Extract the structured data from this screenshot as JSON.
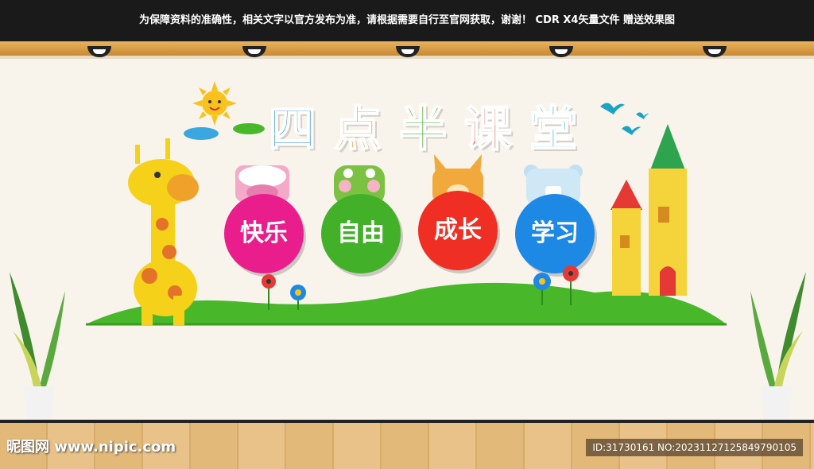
{
  "top_notice": "为保障资料的准确性，相关文字以官方发布为准，请根据需要自行至官网获取，谢谢！   CDR X4矢量文件  赠送效果图",
  "title": {
    "chars": [
      "四",
      "点",
      "半",
      "课",
      "堂"
    ],
    "colors": [
      "#1e88e5",
      "#f57c00",
      "#43b02a",
      "#e53935",
      "#1ba3c6"
    ]
  },
  "bubbles": [
    {
      "label": "快乐",
      "color": "#e91e8c"
    },
    {
      "label": "自由",
      "color": "#43b02a"
    },
    {
      "label": "成长",
      "color": "#ef2e24"
    },
    {
      "label": "学习",
      "color": "#1e88e5"
    }
  ],
  "watermark": {
    "brand": "昵图网 www.nipic.com",
    "id": "ID:31730161 NO:20231127125849790105"
  },
  "colors": {
    "grass": "#48b82a",
    "giraffe": "#f6d11a",
    "castle": "#f5d33a"
  }
}
